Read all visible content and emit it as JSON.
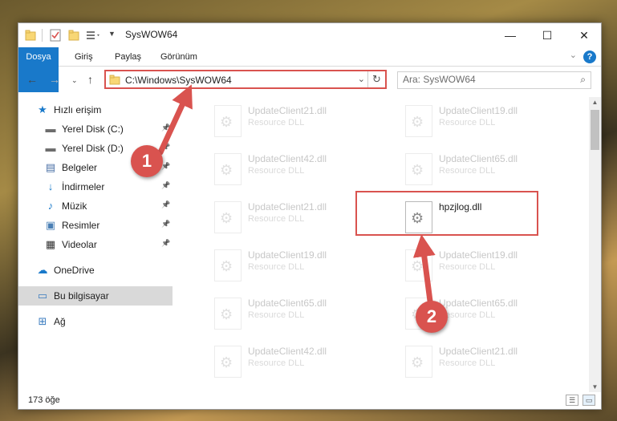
{
  "window": {
    "title": "SysWOW64",
    "minimize_glyph": "—",
    "maximize_glyph": "☐",
    "close_glyph": "✕"
  },
  "ribbon": {
    "tabs": [
      "Dosya",
      "Giriş",
      "Paylaş",
      "Görünüm"
    ],
    "help_glyph": "?"
  },
  "address_bar": {
    "path": "C:\\Windows\\SysWOW64"
  },
  "search": {
    "placeholder": "Ara: SysWOW64"
  },
  "sidebar": {
    "items": [
      {
        "label": "Hızlı erişim",
        "icon": "star-icon",
        "glyph": "★",
        "color": "#1979ca"
      },
      {
        "label": "Yerel Disk (C:)",
        "icon": "drive-icon",
        "glyph": "▬",
        "color": "#6d6d6d"
      },
      {
        "label": "Yerel Disk (D:)",
        "icon": "drive-icon",
        "glyph": "▬",
        "color": "#6d6d6d"
      },
      {
        "label": "Belgeler",
        "icon": "documents-icon",
        "glyph": "▤",
        "color": "#4a6fa5"
      },
      {
        "label": "İndirmeler",
        "icon": "download-icon",
        "glyph": "↓",
        "color": "#1979ca"
      },
      {
        "label": "Müzik",
        "icon": "music-icon",
        "glyph": "♪",
        "color": "#1979ca"
      },
      {
        "label": "Resimler",
        "icon": "pictures-icon",
        "glyph": "▣",
        "color": "#4a7fb5"
      },
      {
        "label": "Videolar",
        "icon": "video-icon",
        "glyph": "▦",
        "color": "#333333"
      },
      {
        "label": "OneDrive",
        "icon": "cloud-icon",
        "glyph": "☁",
        "color": "#1979ca"
      },
      {
        "label": "Bu bilgisayar",
        "icon": "computer-icon",
        "glyph": "▭",
        "color": "#3a7bbf"
      },
      {
        "label": "Ağ",
        "icon": "network-icon",
        "glyph": "⊞",
        "color": "#3a7bbf"
      }
    ]
  },
  "files": [
    {
      "name": "UpdateClient21.dll",
      "type": "Resource DLL"
    },
    {
      "name": "UpdateClient19.dll",
      "type": "Resource DLL"
    },
    {
      "name": "UpdateClient42.dll",
      "type": "Resource DLL"
    },
    {
      "name": "UpdateClient65.dll",
      "type": "Resource DLL"
    },
    {
      "name": "UpdateClient21.dll",
      "type": "Resource DLL"
    },
    {
      "name": "hpzjlog.dll",
      "type": ""
    },
    {
      "name": "UpdateClient19.dll",
      "type": "Resource DLL"
    },
    {
      "name": "UpdateClient19.dll",
      "type": "Resource DLL"
    },
    {
      "name": "UpdateClient65.dll",
      "type": "Resource DLL"
    },
    {
      "name": "UpdateClient65.dll",
      "type": "Resource DLL"
    },
    {
      "name": "UpdateClient42.dll",
      "type": "Resource DLL"
    },
    {
      "name": "UpdateClient21.dll",
      "type": "Resource DLL"
    }
  ],
  "status": {
    "item_count": "173 öğe"
  },
  "annotations": {
    "step1": "1",
    "step2": "2",
    "accent_color": "#d9534f"
  }
}
